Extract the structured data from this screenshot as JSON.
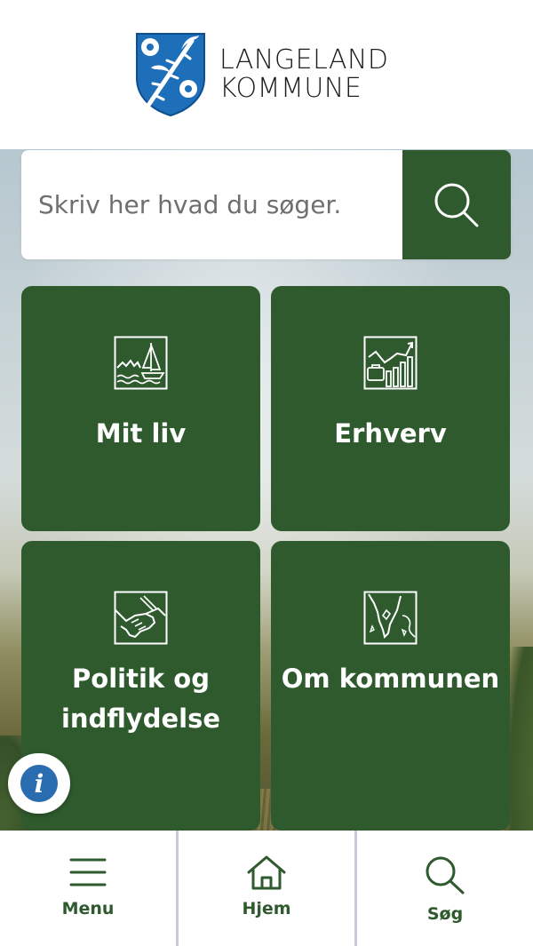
{
  "brand": {
    "name_line1": "LANGELAND",
    "name_line2": "KOMMUNE",
    "crest_colors": {
      "shield": "#1e6fb9",
      "border": "#0f4f8f",
      "branch": "#ffffff"
    }
  },
  "search": {
    "placeholder": "Skriv her hvad du søger.",
    "button_icon": "search-icon"
  },
  "tiles": [
    {
      "label": "Mit liv",
      "icon": "landscape-boat-icon"
    },
    {
      "label": "Erhverv",
      "icon": "business-growth-chart-icon"
    },
    {
      "label": "Politik og indflydelse",
      "icon": "handshake-icon"
    },
    {
      "label": "Om kommunen",
      "icon": "island-map-icon"
    }
  ],
  "info_button": {
    "icon": "info-icon",
    "glyph": "i"
  },
  "bottom_nav": [
    {
      "label": "Menu",
      "icon": "hamburger-menu-icon"
    },
    {
      "label": "Hjem",
      "icon": "home-icon"
    },
    {
      "label": "Søg",
      "icon": "search-icon"
    }
  ],
  "colors": {
    "primary_green": "#2e5a2e",
    "text_on_green": "#ffffff",
    "divider": "#c9c8dc",
    "info_blue": "#2a6cb0"
  }
}
